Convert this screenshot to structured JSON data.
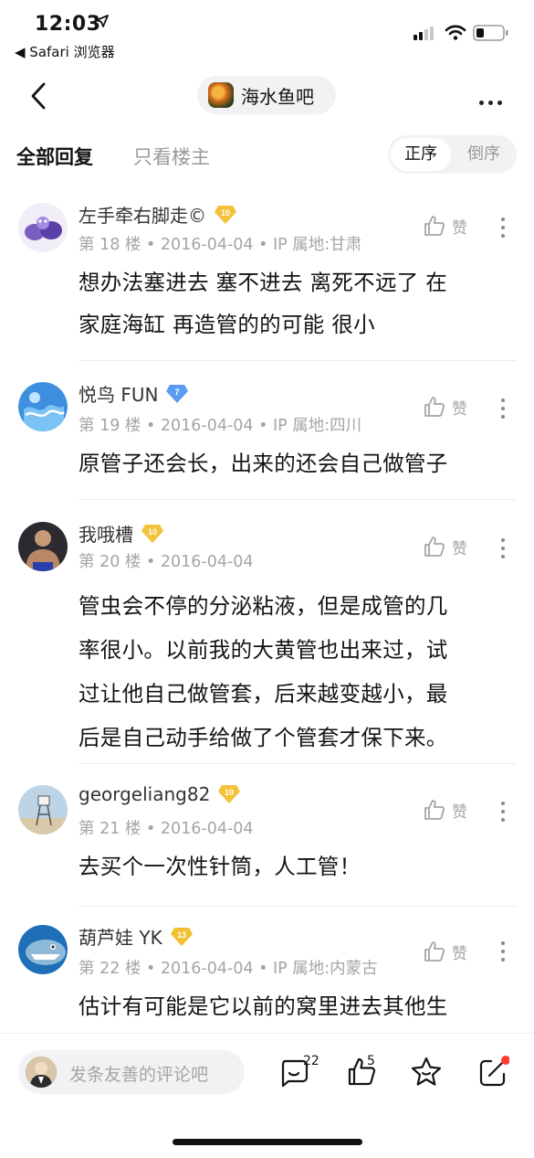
{
  "status": {
    "time": "12:03",
    "back_app": "◀ Safari 浏览器"
  },
  "nav": {
    "forum_name": "海水鱼吧"
  },
  "tabs": {
    "all": "全部回复",
    "owner_only": "只看楼主",
    "order_asc": "正序",
    "order_desc": "倒序"
  },
  "posts": [
    {
      "username": "左手牵右脚走©",
      "level": "10",
      "meta": "第 18 楼 • 2016-04-04 • IP 属地:甘肃",
      "like_label": "赞",
      "lines": [
        "想办法塞进去 塞不进去 离死不远了 在",
        "家庭海缸 再造管的的可能 很小"
      ]
    },
    {
      "username": "悦鸟 FUN",
      "level": "7",
      "meta": "第 19 楼 • 2016-04-04 • IP 属地:四川",
      "like_label": "赞",
      "lines": [
        "原管子还会长，出来的还会自己做管子"
      ]
    },
    {
      "username": "我哦槽",
      "level": "10",
      "meta": "第 20 楼 • 2016-04-04",
      "like_label": "赞",
      "lines": [
        "管虫会不停的分泌粘液，但是成管的几",
        "率很小。以前我的大黄管也出来过，试",
        "过让他自己做管套，后来越变越小，最",
        "后是自己动手给做了个管套才保下来。"
      ]
    },
    {
      "username": "georgeliang82",
      "level": "10",
      "meta": "第 21 楼 • 2016-04-04",
      "like_label": "赞",
      "lines": [
        "去买个一次性针筒，人工管！"
      ]
    },
    {
      "username": "葫芦娃 YK",
      "level": "13",
      "meta": "第 22 楼 • 2016-04-04 • IP 属地:内蒙古",
      "like_label": "赞",
      "lines": [
        "估计有可能是它以前的窝里进去其他生"
      ]
    }
  ],
  "bottom": {
    "comment_placeholder": "发条友善的评论吧",
    "comment_count": "22",
    "like_count": "5"
  },
  "icons": [
    "location-arrow-icon",
    "signal-icon",
    "wifi-icon",
    "battery-icon",
    "back-chevron-icon",
    "more-icon",
    "thumb-up-icon",
    "comment-icon",
    "star-icon",
    "share-icon"
  ],
  "colors": {
    "badge_gold": "#f3c23a",
    "badge_blue": "#5b9bf0",
    "badge_level13": "#f0c030",
    "muted_text": "#a5a5a5",
    "notify_red": "#ff3b30"
  }
}
